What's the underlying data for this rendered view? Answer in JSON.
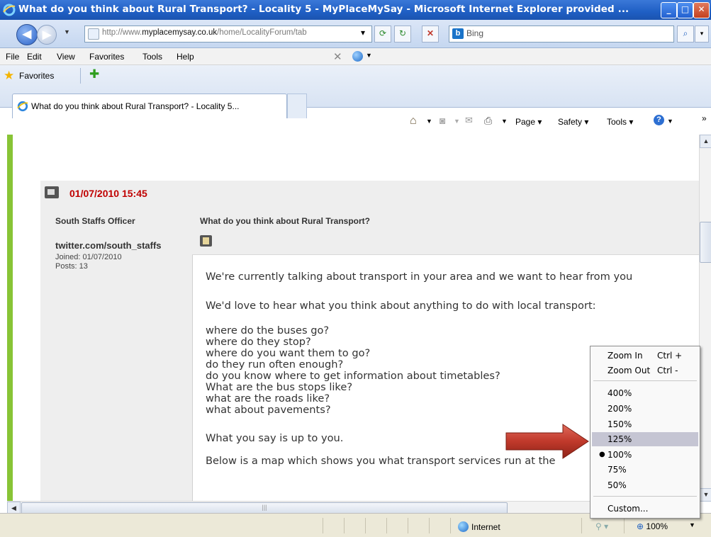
{
  "window": {
    "title": "What do you think about Rural Transport? - Locality 5 - MyPlaceMySay - Microsoft Internet Explorer provided ..."
  },
  "address_bar": {
    "url_prefix": "http://www.",
    "url_domain": "myplacemysay.co.uk",
    "url_path": "/home/LocalityForum/tab"
  },
  "search": {
    "provider": "Bing",
    "logo_letter": "b"
  },
  "menu": [
    "File",
    "Edit",
    "View",
    "Favorites",
    "Tools",
    "Help"
  ],
  "favorites": {
    "label": "Favorites"
  },
  "tab": {
    "label": "What do you think about Rural Transport? - Locality 5..."
  },
  "command_bar": {
    "page": "Page",
    "safety": "Safety",
    "tools": "Tools"
  },
  "post": {
    "date": "01/07/2010 15:45",
    "author": {
      "name": "South Staffs Officer",
      "twitter": "twitter.com/south_staffs",
      "joined": "Joined: 01/07/2010",
      "posts": "Posts: 13"
    },
    "title": "What do you think about Rural Transport?",
    "intro": "We're currently talking about transport in your area and we want to hear from you",
    "lead": "We'd love to hear what you think about anything to do with local transport:",
    "questions": [
      "where do the buses go?",
      "where do they stop?",
      "where do you want them to go?",
      "do they run often enough?",
      "do you know where to get information about timetables?",
      "What are the bus stops like?",
      "what are the roads like?",
      "what about pavements?"
    ],
    "closing": "What you say is up to you.",
    "map_text": "Below is a map which shows you what transport services run at the"
  },
  "status_bar": {
    "zone": "Internet",
    "zoom": "100%"
  },
  "zoom_menu": {
    "zoom_in": "Zoom In",
    "zoom_in_key": "Ctrl +",
    "zoom_out": "Zoom Out",
    "zoom_out_key": "Ctrl -",
    "levels": [
      "400%",
      "200%",
      "150%",
      "125%",
      "100%",
      "75%",
      "50%"
    ],
    "highlighted": "125%",
    "current": "100%",
    "custom": "Custom..."
  },
  "colors": {
    "accent_green": "#88c436",
    "date_red": "#c00000",
    "arrow_red": "#c0392b"
  }
}
